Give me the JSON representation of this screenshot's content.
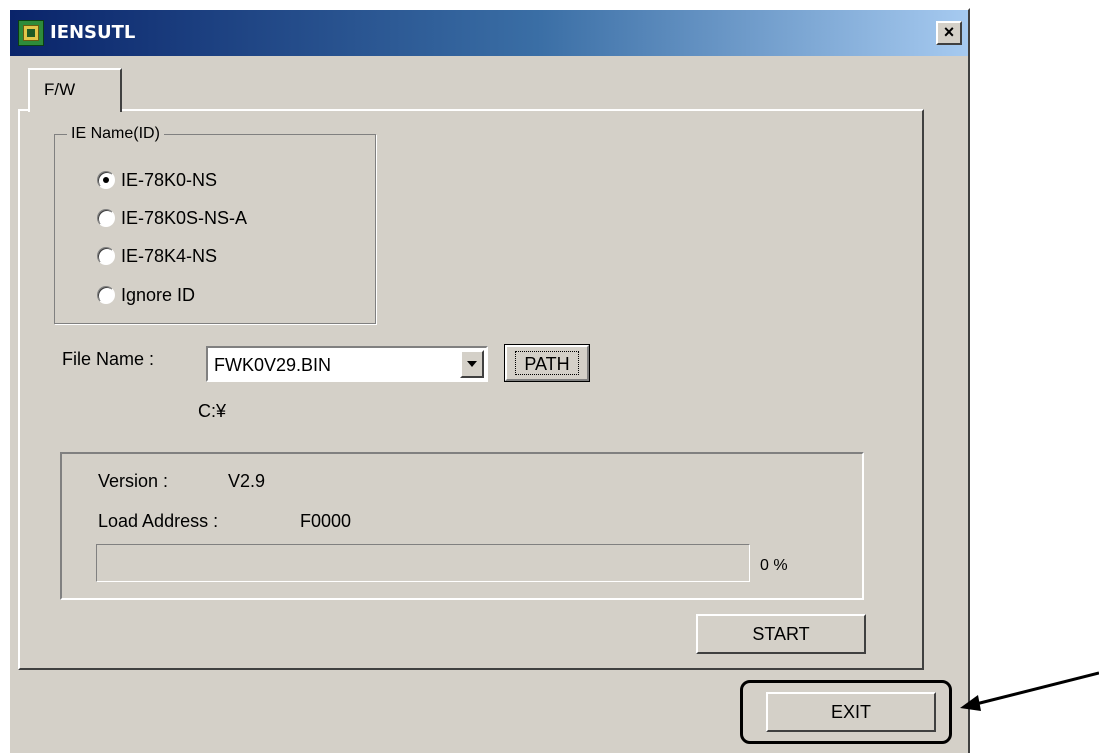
{
  "window": {
    "title": "IENSUTL",
    "close_label": "×"
  },
  "tabs": [
    {
      "label": "F/W",
      "selected": true
    }
  ],
  "ie_name_group": {
    "legend": "IE Name(ID)",
    "options": [
      {
        "label": "IE-78K0-NS",
        "selected": true
      },
      {
        "label": "IE-78K0S-NS-A",
        "selected": false
      },
      {
        "label": "IE-78K4-NS",
        "selected": false
      },
      {
        "label": "Ignore ID",
        "selected": false
      }
    ]
  },
  "file": {
    "label": "File Name :",
    "selected_value": "FWK0V29.BIN",
    "path_button_label": "PATH",
    "path": "C:¥"
  },
  "info": {
    "version_label": "Version :",
    "version_value": "V2.9",
    "load_address_label": "Load Address :",
    "load_address_value": "F0000",
    "progress_percent": 0,
    "progress_text": "0 %"
  },
  "buttons": {
    "start": "START",
    "exit": "EXIT"
  },
  "colors": {
    "window_bg": "#d4d0c8",
    "titlebar_start": "#0a246a",
    "titlebar_end": "#a6caf0",
    "annotation": "#000000"
  }
}
